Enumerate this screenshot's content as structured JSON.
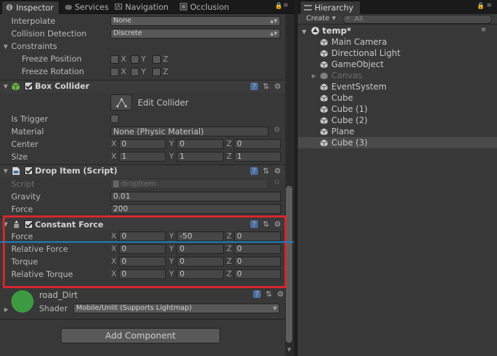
{
  "inspector_tab": {
    "label": "Inspector"
  },
  "tabs": [
    {
      "label": "Services"
    },
    {
      "label": "Navigation"
    },
    {
      "label": "Occlusion"
    }
  ],
  "rigidbody": {
    "interpolate": {
      "label": "Interpolate",
      "value": "None"
    },
    "collision": {
      "label": "Collision Detection",
      "value": "Discrete"
    },
    "constraints": {
      "label": "Constraints"
    },
    "freeze_position": {
      "label": "Freeze Position"
    },
    "freeze_rotation": {
      "label": "Freeze Rotation"
    },
    "axes": [
      "X",
      "Y",
      "Z"
    ]
  },
  "box_collider": {
    "title": "Box Collider",
    "edit": "Edit Collider",
    "is_trigger": "Is Trigger",
    "material": {
      "label": "Material",
      "value": "None (Physic Material)"
    },
    "center": {
      "label": "Center",
      "x": "0",
      "y": "0",
      "z": "0"
    },
    "size": {
      "label": "Size",
      "x": "1",
      "y": "1",
      "z": "1"
    }
  },
  "drop_item": {
    "title": "Drop Item (Script)",
    "script": {
      "label": "Script",
      "value": "dropItem"
    },
    "gravity": {
      "label": "Gravity",
      "value": "0.01"
    },
    "force": {
      "label": "Force",
      "value": "200"
    }
  },
  "constant_force": {
    "title": "Constant Force",
    "rows": [
      {
        "label": "Force",
        "x": "0",
        "y": "-50",
        "z": "0"
      },
      {
        "label": "Relative Force",
        "x": "0",
        "y": "0",
        "z": "0"
      },
      {
        "label": "Torque",
        "x": "0",
        "y": "0",
        "z": "0"
      },
      {
        "label": "Relative Torque",
        "x": "0",
        "y": "0",
        "z": "0"
      }
    ]
  },
  "material": {
    "name": "road_Dirt",
    "shader_label": "Shader",
    "shader_value": "Mobile/Unlit (Supports Lightmap)"
  },
  "add_component": "Add Component",
  "hierarchy": {
    "tab": "Hierarchy",
    "create": "Create",
    "search_placeholder": "All",
    "scene": "temp*",
    "items": [
      "Main Camera",
      "Directional Light",
      "GameObject",
      "Canvas",
      "EventSystem",
      "Cube",
      "Cube (1)",
      "Cube (2)",
      "Plane",
      "Cube (3)"
    ]
  }
}
